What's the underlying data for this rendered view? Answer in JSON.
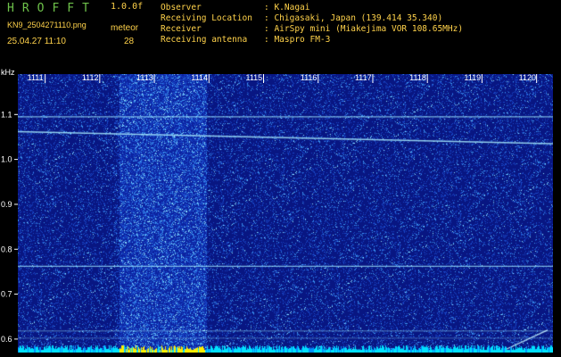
{
  "header": {
    "app_title": "HROFFT",
    "version": "1.0.0f",
    "filename": "KN9_2504271110.png",
    "mode": "meteor",
    "datetime": "25.04.27 11:10",
    "count": "28",
    "info_rows": [
      {
        "label": "Observer",
        "value": ": K.Nagai"
      },
      {
        "label": "Receiving Location",
        "value": ": Chigasaki, Japan (139.414 35.340)"
      },
      {
        "label": "Receiver",
        "value": ": AirSpy mini (Miakejima VOR 108.65MHz)"
      },
      {
        "label": "Receiving antenna",
        "value": ": Maspro FM-3"
      }
    ]
  },
  "spectrogram": {
    "y_unit": "kHz",
    "y_ticks": [
      "1.1",
      "1.0",
      "0.9",
      "0.8",
      "0.7",
      "0.6"
    ],
    "y_tick_values": [
      1.1,
      1.0,
      0.9,
      0.8,
      0.7,
      0.6
    ],
    "y_range": [
      0.57,
      1.19
    ],
    "x_ticks": [
      "1111",
      "1112",
      "1113",
      "1114",
      "1115",
      "1116",
      "1117",
      "1118",
      "1119",
      "1120"
    ],
    "x_range": [
      1110.5,
      1120.3
    ],
    "colors": {
      "background": "#0a1e8c",
      "noise_low": "#1a3cc8",
      "noise_high": "#4fb4ff",
      "signal": "#7fe6ff",
      "baseline": "#00e0ff",
      "baseline_bright": "#ffee00"
    }
  }
}
